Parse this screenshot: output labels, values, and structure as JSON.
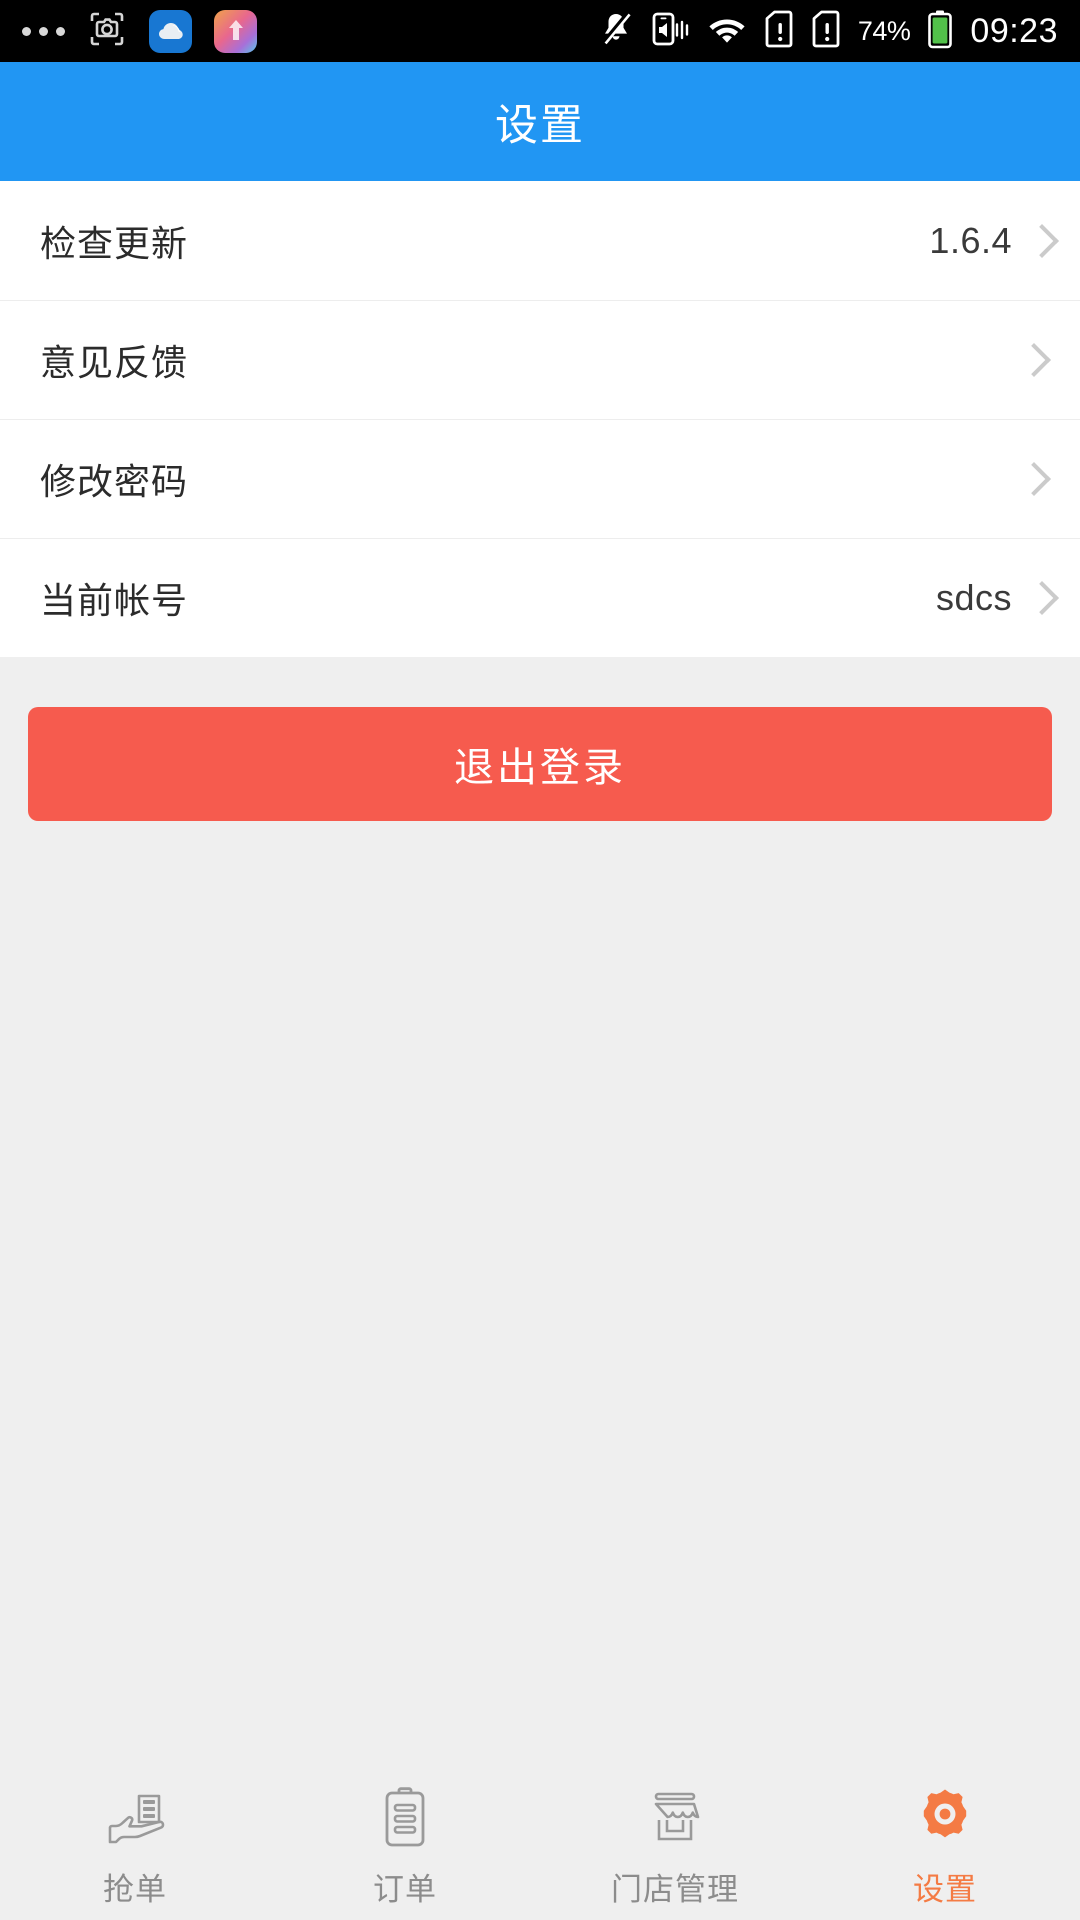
{
  "status_bar": {
    "notification_icons": [
      "more-dots-icon",
      "screenshot-camera-icon",
      "cloud-app-icon",
      "gradient-app-icon"
    ],
    "system_icons": [
      "bell-muted-icon",
      "phone-vibrate-icon",
      "wifi-icon",
      "sim-card-alert-icon",
      "sim-card-alert-2-icon"
    ],
    "battery_percent": "74%",
    "time": "09:23"
  },
  "header": {
    "title": "设置"
  },
  "settings": {
    "rows": [
      {
        "label": "检查更新",
        "value": "1.6.4"
      },
      {
        "label": "意见反馈",
        "value": ""
      },
      {
        "label": "修改密码",
        "value": ""
      },
      {
        "label": "当前帐号",
        "value": "sdcs"
      }
    ]
  },
  "logout": {
    "label": "退出登录",
    "color": "#F65B4E"
  },
  "tab_bar": {
    "active_color": "#F47B44",
    "inactive_color": "#8C8C8C",
    "tabs": [
      {
        "label": "抢单",
        "icon": "hand-holding-order-icon",
        "active": false
      },
      {
        "label": "订单",
        "icon": "clipboard-order-icon",
        "active": false
      },
      {
        "label": "门店管理",
        "icon": "storefront-icon",
        "active": false
      },
      {
        "label": "设置",
        "icon": "gear-icon",
        "active": true
      }
    ]
  },
  "colors": {
    "header_blue": "#2196F3",
    "page_background": "#EFEFEF",
    "card_background": "#FFFFFF"
  }
}
